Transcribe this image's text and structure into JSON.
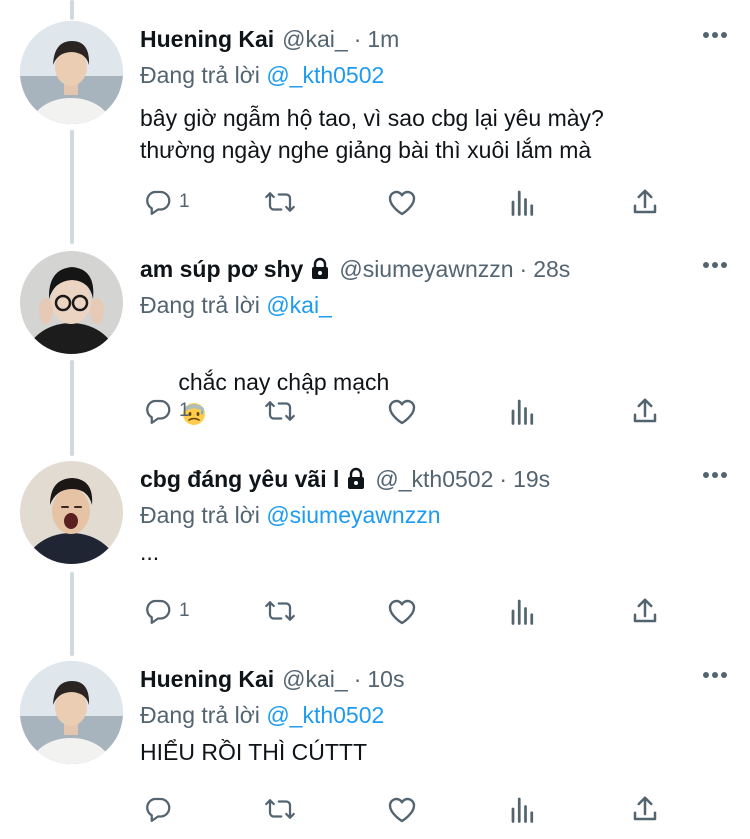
{
  "reply_prefix": "Đang trả lời",
  "tweets": [
    {
      "display_name": "Huening Kai",
      "handle": "@kai_",
      "time": "1m",
      "reply_to": "@_kth0502",
      "text": "bây giờ ngẫm hộ tao, vì sao cbg lại yêu mày?\nthường ngày nghe giảng bài thì xuôi lắm mà",
      "reply_count": "1",
      "protected": false
    },
    {
      "display_name": "am súp pơ shy",
      "handle": "@siumeyawnzzn",
      "time": "28s",
      "reply_to": "@kai_",
      "text": "chắc nay chập mạch",
      "emoji": "anxious-face-with-sweat",
      "reply_count": "1",
      "protected": true
    },
    {
      "display_name": "cbg đáng yêu vãi l",
      "handle": "@_kth0502",
      "time": "19s",
      "reply_to": "@siumeyawnzzn",
      "text": "...",
      "reply_count": "1",
      "protected": true
    },
    {
      "display_name": "Huening Kai",
      "handle": "@kai_",
      "time": "10s",
      "reply_to": "@_kth0502",
      "text": "HIỂU RỒI THÌ CÚTTT",
      "reply_count": "",
      "protected": false
    }
  ],
  "colors": {
    "link": "#1d9bf0",
    "secondary_text": "#536471",
    "primary_text": "#0f1419",
    "thread_line": "#cfd9de"
  },
  "icons": [
    "reply-icon",
    "retweet-icon",
    "like-icon",
    "views-icon",
    "share-icon",
    "more-icon",
    "lock-icon"
  ]
}
